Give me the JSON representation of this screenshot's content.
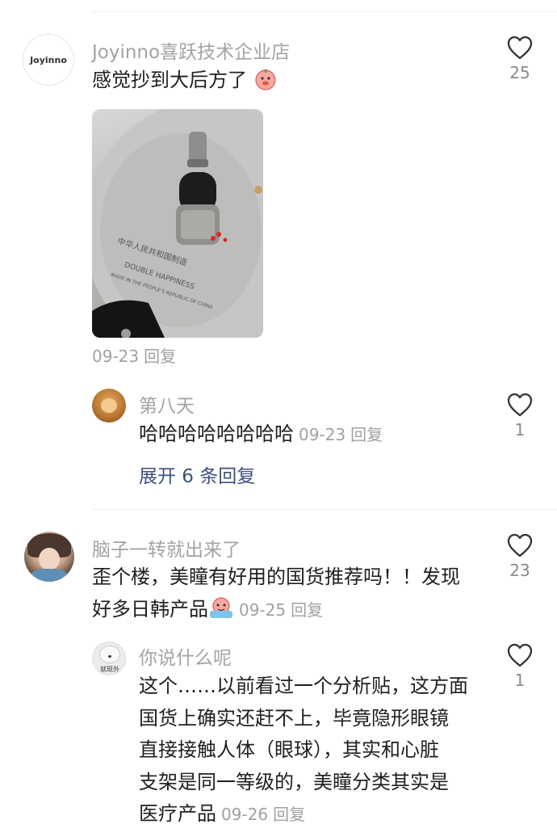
{
  "comments": [
    {
      "username": "Joyinno喜跃技术企业店",
      "avatar_text": "Joyinno",
      "text": "感觉抄到大后方了",
      "image_caption": "中华人民共和国制造",
      "image_sub": "MADE IN THE PEOPLE'S REPUBLIC OF CHINA",
      "image_brand": "DOUBLE HAPPINESS",
      "date": "09-23",
      "reply_label": "回复",
      "likes": "25",
      "replies": [
        {
          "username": "第八天",
          "text": "哈哈哈哈哈哈哈哈",
          "date": "09-23",
          "reply_label": "回复",
          "likes": "1"
        }
      ],
      "expand_label": "展开 6 条回复"
    },
    {
      "username": "脑子一转就出来了",
      "text_line1": "歪个楼，美瞳有好用的国货推荐吗！！发现",
      "text_line2": "好多日韩产品",
      "date": "09-25",
      "reply_label": "回复",
      "likes": "23",
      "replies": [
        {
          "username": "你说什么呢",
          "avatar_text": "就现外",
          "lines": [
            "这个……以前看过一个分析贴，这方面",
            "国货上确实还赶不上，毕竟隐形眼镜",
            "直接接触人体（眼球），其实和心脏",
            "支架是同一等级的，美瞳分类其实是",
            "医疗产品"
          ],
          "date": "09-26",
          "reply_label": "回复",
          "likes": "1"
        }
      ]
    }
  ],
  "icons": {
    "like": "heart-outline-icon"
  },
  "colors": {
    "link": "#3d4f7d",
    "meta": "#a0a0a0",
    "text": "#1f1f1f"
  }
}
